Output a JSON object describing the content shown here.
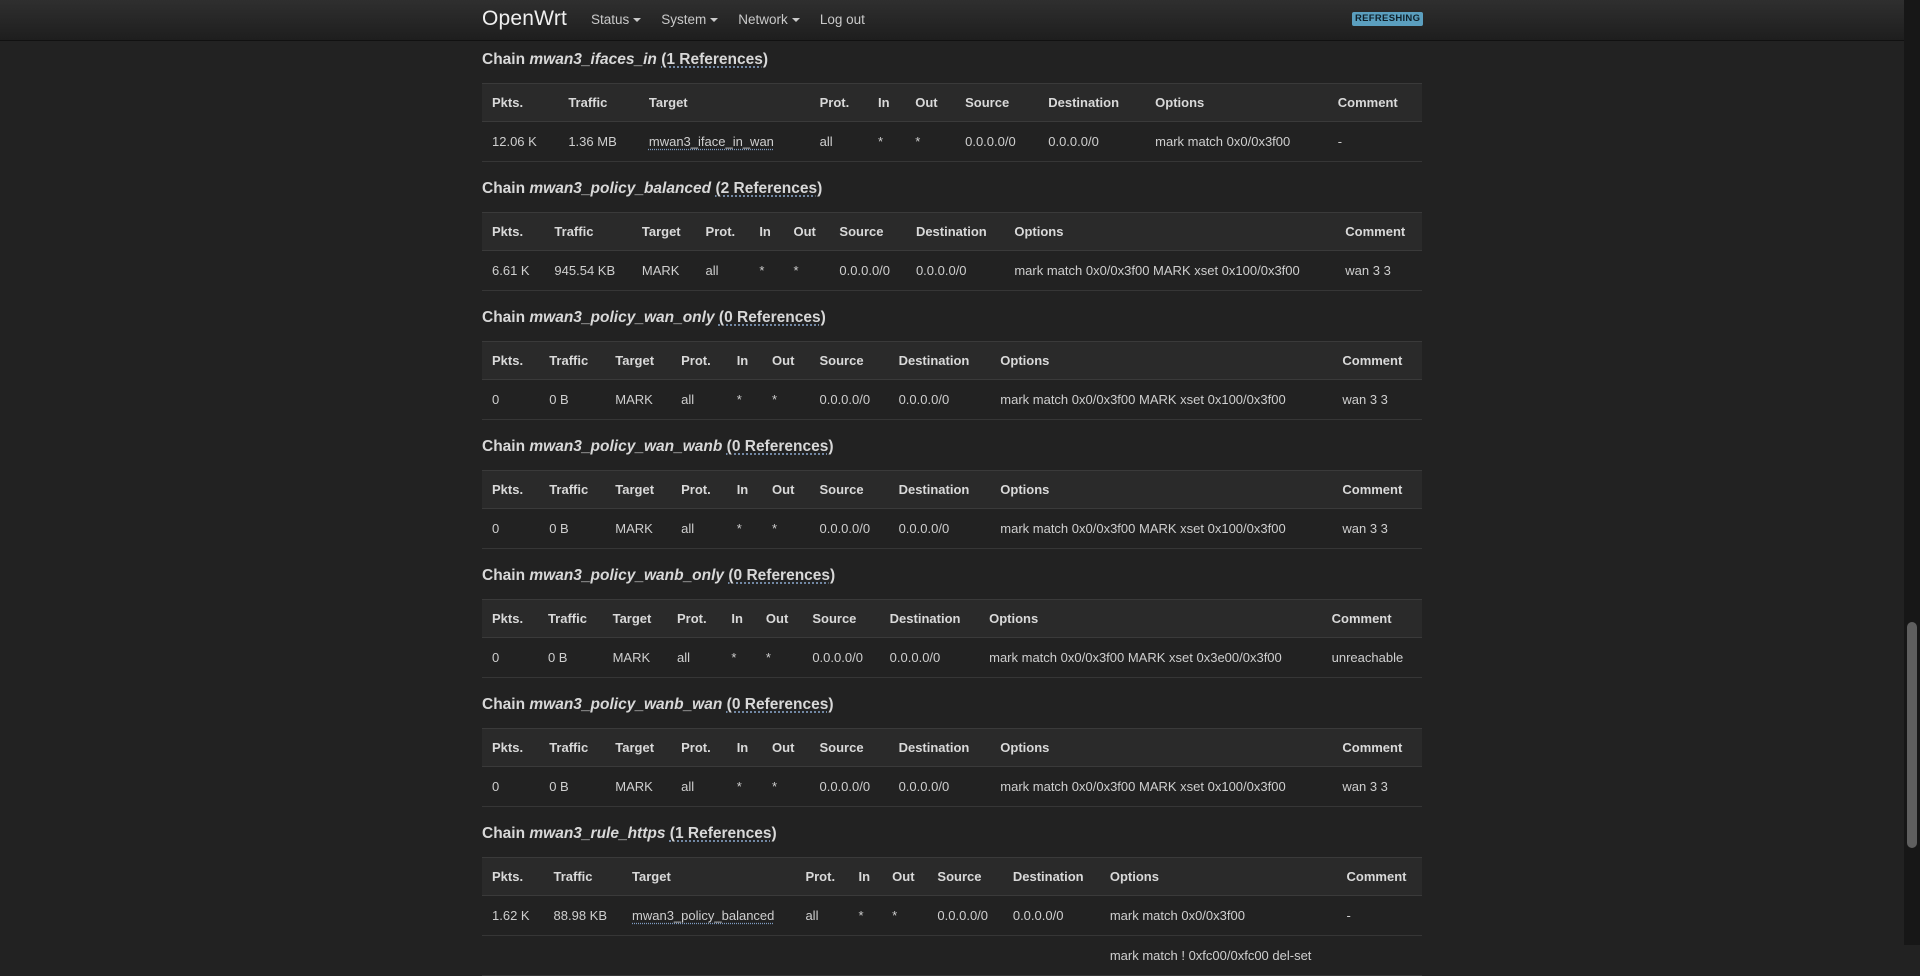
{
  "nav": {
    "brand": "OpenWrt",
    "menu": [
      {
        "label": "Status"
      },
      {
        "label": "System"
      },
      {
        "label": "Network"
      },
      {
        "label": "Log out"
      }
    ],
    "badge": "REFRESHING"
  },
  "chains": [
    {
      "prefix": "Chain ",
      "name": "mwan3_ifaces_in",
      "refs": "(1 References)",
      "columns": [
        "Pkts.",
        "Traffic",
        "Target",
        "Prot.",
        "In",
        "Out",
        "Source",
        "Destination",
        "Options",
        "Comment"
      ],
      "rows": [
        [
          "12.06 K",
          "1.36 MB",
          "mwan3_iface_in_wan",
          "all",
          "*",
          "*",
          "0.0.0.0/0",
          "0.0.0.0/0",
          "mark match 0x0/0x3f00",
          "-"
        ]
      ]
    },
    {
      "prefix": "Chain ",
      "name": "mwan3_policy_balanced",
      "refs": "(2 References)",
      "columns": [
        "Pkts.",
        "Traffic",
        "Target",
        "Prot.",
        "In",
        "Out",
        "Source",
        "Destination",
        "Options",
        "Comment"
      ],
      "rows": [
        [
          "6.61 K",
          "945.54 KB",
          "MARK",
          "all",
          "*",
          "*",
          "0.0.0.0/0",
          "0.0.0.0/0",
          "mark match 0x0/0x3f00 MARK xset 0x100/0x3f00",
          "wan 3 3"
        ]
      ]
    },
    {
      "prefix": "Chain ",
      "name": "mwan3_policy_wan_only",
      "refs": "(0 References)",
      "columns": [
        "Pkts.",
        "Traffic",
        "Target",
        "Prot.",
        "In",
        "Out",
        "Source",
        "Destination",
        "Options",
        "Comment"
      ],
      "rows": [
        [
          "0",
          "0 B",
          "MARK",
          "all",
          "*",
          "*",
          "0.0.0.0/0",
          "0.0.0.0/0",
          "mark match 0x0/0x3f00 MARK xset 0x100/0x3f00",
          "wan 3 3"
        ]
      ]
    },
    {
      "prefix": "Chain ",
      "name": "mwan3_policy_wan_wanb",
      "refs": "(0 References)",
      "columns": [
        "Pkts.",
        "Traffic",
        "Target",
        "Prot.",
        "In",
        "Out",
        "Source",
        "Destination",
        "Options",
        "Comment"
      ],
      "rows": [
        [
          "0",
          "0 B",
          "MARK",
          "all",
          "*",
          "*",
          "0.0.0.0/0",
          "0.0.0.0/0",
          "mark match 0x0/0x3f00 MARK xset 0x100/0x3f00",
          "wan 3 3"
        ]
      ]
    },
    {
      "prefix": "Chain ",
      "name": "mwan3_policy_wanb_only",
      "refs": "(0 References)",
      "columns": [
        "Pkts.",
        "Traffic",
        "Target",
        "Prot.",
        "In",
        "Out",
        "Source",
        "Destination",
        "Options",
        "Comment"
      ],
      "rows": [
        [
          "0",
          "0 B",
          "MARK",
          "all",
          "*",
          "*",
          "0.0.0.0/0",
          "0.0.0.0/0",
          "mark match 0x0/0x3f00 MARK xset 0x3e00/0x3f00",
          "unreachable"
        ]
      ]
    },
    {
      "prefix": "Chain ",
      "name": "mwan3_policy_wanb_wan",
      "refs": "(0 References)",
      "columns": [
        "Pkts.",
        "Traffic",
        "Target",
        "Prot.",
        "In",
        "Out",
        "Source",
        "Destination",
        "Options",
        "Comment"
      ],
      "rows": [
        [
          "0",
          "0 B",
          "MARK",
          "all",
          "*",
          "*",
          "0.0.0.0/0",
          "0.0.0.0/0",
          "mark match 0x0/0x3f00 MARK xset 0x100/0x3f00",
          "wan 3 3"
        ]
      ]
    },
    {
      "prefix": "Chain ",
      "name": "mwan3_rule_https",
      "refs": "(1 References)",
      "columns": [
        "Pkts.",
        "Traffic",
        "Target",
        "Prot.",
        "In",
        "Out",
        "Source",
        "Destination",
        "Options",
        "Comment"
      ],
      "rows": [
        [
          "1.62 K",
          "88.98 KB",
          "mwan3_policy_balanced",
          "all",
          "*",
          "*",
          "0.0.0.0/0",
          "0.0.0.0/0",
          "mark match 0x0/0x3f00",
          "-"
        ],
        [
          "",
          "",
          "",
          "",
          "",
          "",
          "",
          "",
          "mark match ! 0xfc00/0xfc00 del-set",
          ""
        ]
      ]
    }
  ]
}
